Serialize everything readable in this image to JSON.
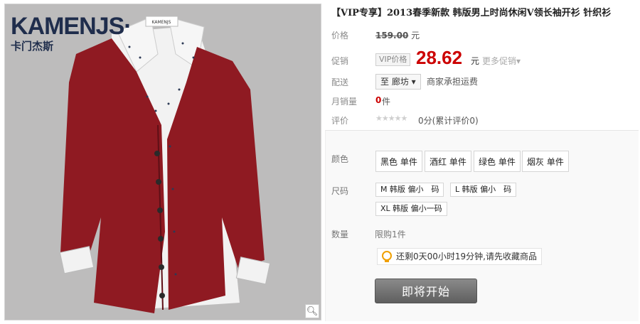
{
  "product": {
    "title": "【VIP专享】2013春季新款 韩版男上时尚休闲V领长袖开衫 针织衫",
    "brand_en": "KAMENJS·",
    "brand_cn": "卡门杰斯",
    "collar_tag": "KAMENJS"
  },
  "labels": {
    "price": "价格",
    "promo": "促销",
    "shipping": "配送",
    "monthly_sales": "月销量",
    "review": "评价",
    "color": "颜色",
    "size": "尺码",
    "quantity": "数量"
  },
  "price": {
    "original": "159.00",
    "currency": "元",
    "vip_tag": "VIP价格",
    "current": "28.62",
    "more_promo": "更多促销"
  },
  "shipping": {
    "destination": "至 廊坊",
    "fee_note": "商家承担运费"
  },
  "sales": {
    "count": "0",
    "unit": "件"
  },
  "rating": {
    "stars": "★★★★★",
    "text": "0分(累计评价0)"
  },
  "colors": [
    "黑色 单件",
    "酒红 单件",
    "绿色 单件",
    "烟灰 单件"
  ],
  "sizes": [
    "M 韩版 偏小　码",
    "L 韩版 偏小　码",
    "XL 韩版 偏小一码"
  ],
  "limit_text": "限购1件",
  "countdown_tip": "还剩0天00小时19分钟,请先收藏商品",
  "buttons": {
    "start": "即将开始"
  },
  "icons": {
    "zoom": "magnifier-icon",
    "tip": "lightbulb-icon"
  },
  "colors_theme": {
    "price_red": "#cc0000",
    "garment_red": "#8f1a22",
    "photo_bg": "#bdbcbc"
  }
}
